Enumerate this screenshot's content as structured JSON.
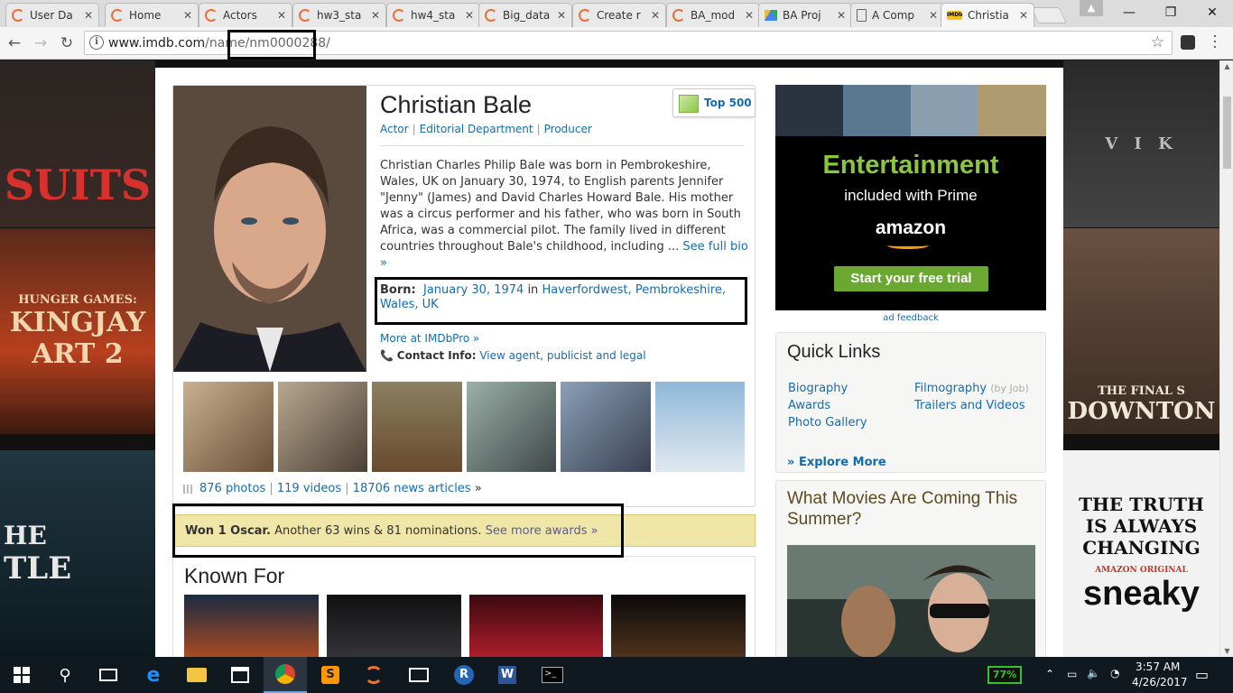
{
  "browser": {
    "tabs": [
      {
        "label": "User Da",
        "icon": "spinner-icon"
      },
      {
        "label": "Home",
        "icon": "spinner-icon"
      },
      {
        "label": "Actors",
        "icon": "spinner-icon"
      },
      {
        "label": "hw3_sta",
        "icon": "spinner-icon"
      },
      {
        "label": "hw4_sta",
        "icon": "spinner-icon"
      },
      {
        "label": "Big_data",
        "icon": "spinner-icon"
      },
      {
        "label": "Create r",
        "icon": "spinner-icon"
      },
      {
        "label": "BA_mod",
        "icon": "spinner-icon"
      },
      {
        "label": "BA Proj",
        "icon": "drive-icon"
      },
      {
        "label": "A Comp",
        "icon": "doc-icon"
      },
      {
        "label": "Christia",
        "icon": "imdb-icon"
      }
    ],
    "url_host": "www.imdb.com",
    "url_path": "/name/nm0000288/"
  },
  "person": {
    "name": "Christian Bale",
    "jobs": [
      "Actor",
      "Editorial Department",
      "Producer"
    ],
    "top500_label": "Top 500",
    "bio": "Christian Charles Philip Bale was born in Pembrokeshire, Wales, UK on January 30, 1974, to English parents Jennifer \"Jenny\" (James) and David Charles Howard Bale. His mother was a circus performer and his father, who was born in South Africa, was a commercial pilot. The family lived in different countries throughout Bale's childhood, including ...",
    "full_bio_link": "See full bio »",
    "born_label": "Born:",
    "born_date": "January 30, 1974",
    "born_in": "in",
    "born_place": "Haverfordwest, Pembrokeshire, Wales, UK",
    "pro_link": "More at IMDbPro »",
    "contact_label": "Contact Info:",
    "contact_link": "View agent, publicist and legal",
    "photos_link": "876 photos",
    "videos_link": "119 videos",
    "news_link": "18706 news articles",
    "news_arrow": "»",
    "awards_bold": "Won 1 Oscar.",
    "awards_text": "Another 63 wins & 81 nominations.",
    "awards_link": "See more awards »",
    "known_for_title": "Known For"
  },
  "ad": {
    "headline": "Entertainment",
    "subline": "included with Prime",
    "brand": "amazon",
    "cta": "Start your free trial",
    "feedback": "ad feedback"
  },
  "quick_links": {
    "title": "Quick Links",
    "left": [
      "Biography",
      "Awards",
      "Photo Gallery"
    ],
    "right": [
      "Filmography",
      "Trailers and Videos"
    ],
    "filmography_note": "(by Job)",
    "explore": "Explore More"
  },
  "coming_soon": {
    "title": "What Movies Are Coming This Summer?"
  },
  "background": {
    "left_texts": [
      "SUITS",
      "HUNGER GAMES:",
      "KINGJAY",
      "ART 2",
      "HE",
      "TLE"
    ],
    "right_texts": [
      "V I K",
      "THE FINAL S",
      "DOWNTON",
      "THE TRUTH",
      "IS ALWAYS",
      "CHANGING",
      "AMAZON ORIGINAL",
      "sneaky"
    ]
  },
  "taskbar": {
    "battery": "77%",
    "time": "3:57 AM",
    "date": "4/26/2017"
  }
}
